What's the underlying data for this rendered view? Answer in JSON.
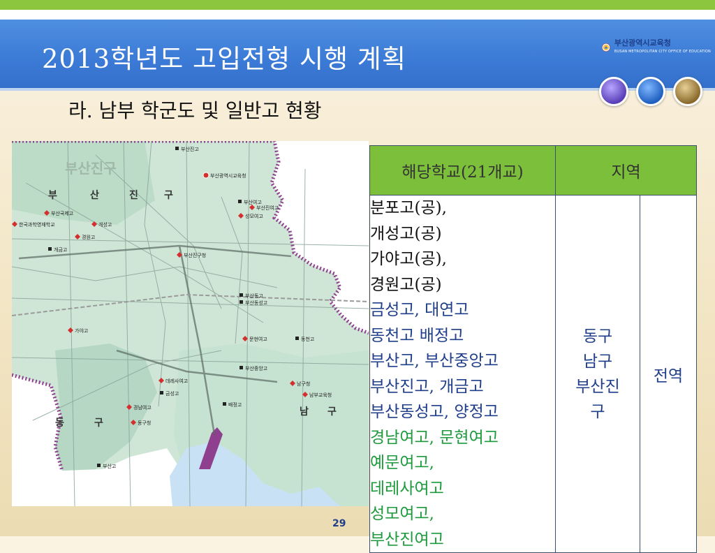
{
  "slide": {
    "title": "2013학년도 고입전형 시행 계획",
    "subtitle": "라. 남부 학군도 및 일반고 현황",
    "page_number": "29"
  },
  "logo": {
    "name": "부산광역시교육청",
    "sub": "BUSAN METROPOLITAN CITY OFFICE OF EDUCATION"
  },
  "map": {
    "district_labels": {
      "busanjin_top": "부산진구",
      "busanjin_1": "부",
      "busanjin_2": "산",
      "busanjin_3": "진",
      "busanjin_4": "구",
      "dong_1": "동",
      "dong_2": "구",
      "nam_1": "남",
      "nam_2": "구"
    },
    "markers": [
      "부산진고",
      "부산광역시교육청",
      "부산국제고",
      "한국과학영재학교",
      "개성고",
      "경원고",
      "개금고",
      "부산진구청",
      "부산여고",
      "부산진여고",
      "성모여고",
      "부산동고",
      "부산동성고",
      "가야고",
      "문현여고",
      "동천고",
      "부산중앙고",
      "데레사여고",
      "금성고",
      "남구청",
      "남부교육청",
      "경남여고",
      "배정고",
      "동구청",
      "부산고"
    ]
  },
  "table": {
    "header_school": "해당학교(21개교)",
    "header_region": "지역",
    "schools": [
      {
        "text": "분포고(공),",
        "color": "black"
      },
      {
        "text": "개성고(공)",
        "color": "black"
      },
      {
        "text": "가야고(공),",
        "color": "black"
      },
      {
        "text": "경원고(공)",
        "color": "black"
      },
      {
        "text": "금성고, 대연고",
        "color": "blue"
      },
      {
        "text": "동천고 배정고",
        "color": "blue"
      },
      {
        "text": "부산고, 부산중앙고",
        "color": "blue"
      },
      {
        "text": "부산진고, 개금고",
        "color": "blue"
      },
      {
        "text": "부산동성고, 양정고",
        "color": "blue"
      },
      {
        "text": "경남여고, 문현여고",
        "color": "green"
      },
      {
        "text": "예문여고,",
        "color": "green"
      },
      {
        "text": "데레사여고",
        "color": "green"
      },
      {
        "text": "성모여고,",
        "color": "green"
      },
      {
        "text": "부산진여고",
        "color": "green"
      }
    ],
    "regions": [
      "동구",
      "남구",
      "부산진",
      "구"
    ],
    "scope": "전역"
  },
  "colors": {
    "header_blue": "#3b7ad6",
    "top_green": "#8cc63f",
    "table_header_green": "#7bbf3a",
    "text_blue": "#1f3f8a",
    "text_green": "#1c9a3c"
  }
}
